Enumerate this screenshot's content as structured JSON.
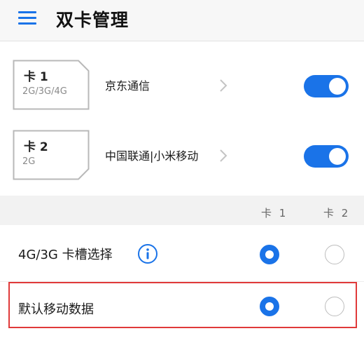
{
  "header": {
    "title": "双卡管理",
    "menu_icon": "hamburger-menu-icon"
  },
  "sims": [
    {
      "slot_label": "卡 1",
      "network_type": "2G/3G/4G",
      "carrier": "京东通信",
      "enabled": true
    },
    {
      "slot_label": "卡 2",
      "network_type": "2G",
      "carrier": "中国联通|小米移动",
      "enabled": true
    }
  ],
  "columns": {
    "card1": "卡 1",
    "card2": "卡 2"
  },
  "options": [
    {
      "label": "4G/3G 卡槽选择",
      "has_info_icon": true,
      "selected_card": 1
    },
    {
      "label": "默认移动数据",
      "has_info_icon": false,
      "selected_card": 1,
      "highlighted": true
    }
  ],
  "colors": {
    "accent": "#1a73e8",
    "highlight_border": "#e03a3a"
  }
}
